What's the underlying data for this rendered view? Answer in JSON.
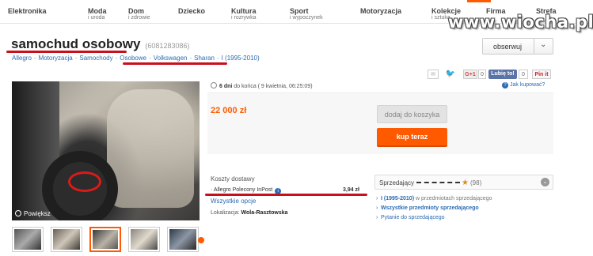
{
  "topnav": {
    "categories": [
      {
        "label": "Elektronika",
        "sub": ""
      },
      {
        "label": "Moda",
        "sub": "i uroda"
      },
      {
        "label": "Dom",
        "sub": "i zdrowie"
      },
      {
        "label": "Dziecko",
        "sub": ""
      },
      {
        "label": "Kultura",
        "sub": "i rozrywka"
      },
      {
        "label": "Sport",
        "sub": "i wypoczynek"
      },
      {
        "label": "Motoryzacja",
        "sub": ""
      },
      {
        "label": "Kolekcje",
        "sub": "i sztuka"
      },
      {
        "label": "Firma",
        "sub": ""
      },
      {
        "label": "Strefa",
        "sub": ""
      }
    ]
  },
  "watermark": "www.wiocha.pl",
  "title": {
    "text": "samochud osobowy",
    "offer_id": "(6081283086)"
  },
  "observe_button": {
    "label": "obserwuj",
    "chevron": "⌄"
  },
  "breadcrumb": [
    "Allegro",
    "Motoryzacja",
    "Samochody",
    "Osobowe",
    "Volkswagen",
    "Sharan",
    "I (1995-2010)"
  ],
  "social": {
    "gplus": "G+1",
    "gplus_count": "0",
    "facebook": "Lubię to!",
    "facebook_count": "0",
    "pinterest": "Pin it"
  },
  "question_link": "Jak kupować?",
  "photo": {
    "zoom_label": "Powiększ"
  },
  "timer": {
    "days": "6 dni",
    "rest": "do końca ( 9 kwietnia, 06:25:09)"
  },
  "price": "22 000 zł",
  "buttons": {
    "add_to_cart": "dodaj do koszyka",
    "buy_now": "kup teraz"
  },
  "shipping": {
    "label": "Koszty dostawy",
    "carrier": "Allegro Polecony InPost",
    "info": "i",
    "cost": "3,94 zł",
    "options_link": "Wszystkie opcje",
    "location_label": "Lokalizacja:",
    "location": "Wola-Rasztowska"
  },
  "seller": {
    "label": "Sprzedający",
    "star": "★",
    "rating_count": "(98)",
    "arrow": "⌄",
    "links": {
      "category_link": "I (1995-2010)",
      "category_suffix": "w przedmiotach sprzedającego",
      "all_items": "Wszystkie przedmioty sprzedającego",
      "ask": "Pytanie do sprzedającego"
    }
  },
  "colors": {
    "accent": "#ff5a00",
    "link": "#2b6bb2",
    "annotation_red": "#c8101d"
  }
}
